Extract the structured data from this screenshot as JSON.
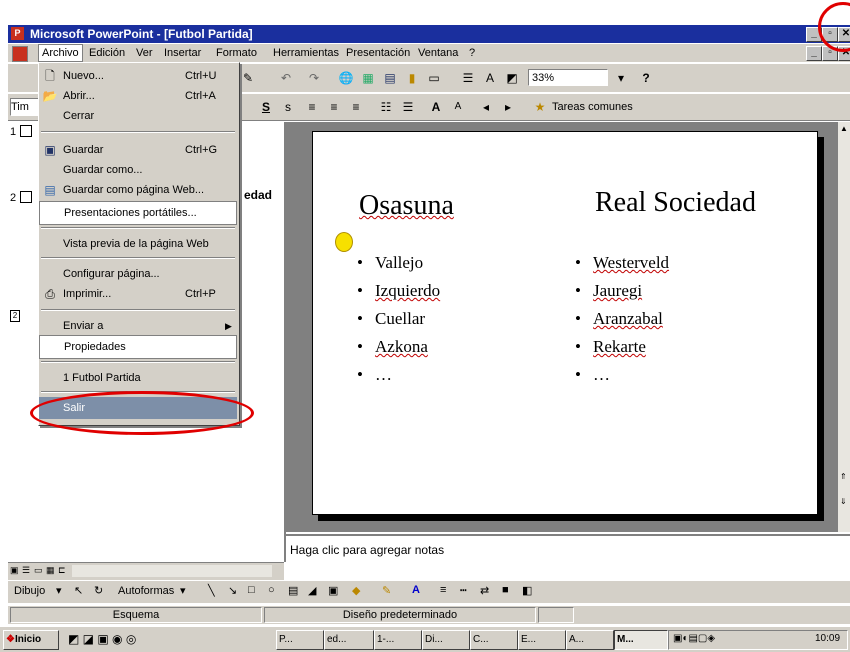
{
  "window": {
    "app_icon_glyph": "P",
    "title": "Microsoft PowerPoint - [Futbol Partida]",
    "controls": [
      "_",
      "▫",
      "✕"
    ]
  },
  "menubar": {
    "items": [
      "Archivo",
      "Edición",
      "Ver",
      "Insertar",
      "Formato",
      "Herramientas",
      "Presentación",
      "Ventana",
      "?"
    ],
    "doc_controls": [
      "_",
      "▫",
      "✕"
    ]
  },
  "toolbar": {
    "zoom": "33%",
    "help_icon": "?",
    "font_name_partial": "Tim",
    "common_tasks": "Tareas comunes"
  },
  "file_menu": {
    "items": [
      {
        "icon": "new-doc-icon",
        "label": "Nuevo...",
        "shortcut": "Ctrl+U"
      },
      {
        "icon": "open-folder-icon",
        "label": "Abrir...",
        "shortcut": "Ctrl+A"
      },
      {
        "icon": "",
        "label": "Cerrar",
        "shortcut": ""
      },
      {
        "icon": "save-disk-icon",
        "label": "Guardar",
        "shortcut": "Ctrl+G"
      },
      {
        "icon": "",
        "label": "Guardar como...",
        "shortcut": ""
      },
      {
        "icon": "save-web-icon",
        "label": "Guardar como página Web...",
        "shortcut": ""
      },
      {
        "icon": "",
        "label": "Presentaciones portátiles...",
        "shortcut": ""
      },
      {
        "icon": "",
        "label": "Vista previa de la página Web",
        "shortcut": ""
      },
      {
        "icon": "",
        "label": "Configurar página...",
        "shortcut": ""
      },
      {
        "icon": "printer-icon",
        "label": "Imprimir...",
        "shortcut": "Ctrl+P"
      },
      {
        "icon": "",
        "label": "Enviar a",
        "shortcut": ""
      },
      {
        "icon": "",
        "label": "Propiedades",
        "shortcut": ""
      },
      {
        "icon": "",
        "label": "1 Futbol Partida",
        "shortcut": ""
      },
      {
        "icon": "",
        "label": "Salir",
        "shortcut": ""
      }
    ]
  },
  "outline": {
    "slide1_number": "1",
    "slide2_number": "2",
    "slide2_fragment": "edad",
    "row3_number": "2"
  },
  "slide": {
    "left_title": "Osasuna",
    "right_title": "Real Sociedad",
    "left_items": [
      "Vallejo",
      "Izquierdo",
      "Cuellar",
      "Azkona",
      "…"
    ],
    "right_items": [
      "Westerveld",
      "Jauregi",
      "Aranzabal",
      "Rekarte",
      "…"
    ],
    "bullet": "•"
  },
  "notes": {
    "placeholder": "Haga clic para agregar notas"
  },
  "drawing_toolbar": {
    "draw_label": "Dibujo",
    "autoshapes_label": "Autoformas"
  },
  "status": {
    "view": "Esquema",
    "design": "Diseño predeterminado"
  },
  "taskbar": {
    "start": "Inicio",
    "tasks": [
      "P...",
      "ed...",
      "1-...",
      "Di...",
      "C...",
      "E...",
      "A...",
      "M..."
    ],
    "clock": "10:09"
  },
  "colors": {
    "titlebar": "#1a2f9e",
    "highlight_circle": "#e00000",
    "chrome": "#d4d0c8"
  }
}
